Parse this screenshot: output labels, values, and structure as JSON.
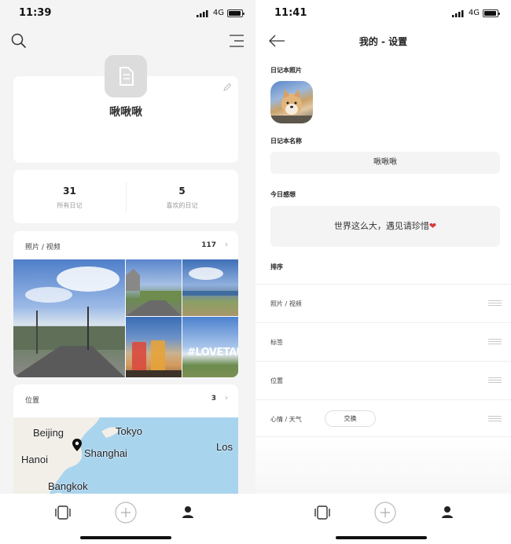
{
  "colors": {
    "background_left": "#f4f4f5",
    "card": "#ffffff",
    "field": "#f4f4f5",
    "heart": "#d93a3a",
    "map_water": "#a9d4ee",
    "map_land": "#f2efe8"
  },
  "left_screen": {
    "status": {
      "time": "11:39",
      "network": "4G"
    },
    "icons": {
      "search": "search-icon",
      "menu": "menu-icon"
    },
    "profile": {
      "name": "啾啾啾",
      "avatar_icon": "document-icon",
      "edit_icon": "pencil-icon"
    },
    "stats": [
      {
        "value": "31",
        "label": "所有日记"
      },
      {
        "value": "5",
        "label": "喜欢的日记"
      }
    ],
    "photos": {
      "title": "照片 / 视频",
      "count": "117",
      "photo_overlay_text": "#LOVETAUPO"
    },
    "location": {
      "title": "位置",
      "count": "3",
      "map_cities": [
        "Beijing",
        "Tokyo",
        "Shanghai",
        "Hanoi",
        "Los",
        "Bangkok"
      ]
    },
    "tabbar": [
      "diary-cards-icon",
      "add-icon",
      "profile-icon"
    ]
  },
  "right_screen": {
    "status": {
      "time": "11:41",
      "network": "4G"
    },
    "nav": {
      "title": "我的 - 设置",
      "back_icon": "back-arrow-icon"
    },
    "cover_label": "日记本照片",
    "name_label": "日记本名称",
    "name_value": "啾啾啾",
    "feeling_label": "今日感想",
    "feeling_value": "世界这么大，遇见请珍惜",
    "sort_label": "排序",
    "sort_rows": [
      "照片 / 视频",
      "标签",
      "位置",
      "心情 / 天气"
    ],
    "swap_label": "交换",
    "tabbar": [
      "diary-cards-icon",
      "add-icon",
      "profile-icon"
    ]
  }
}
